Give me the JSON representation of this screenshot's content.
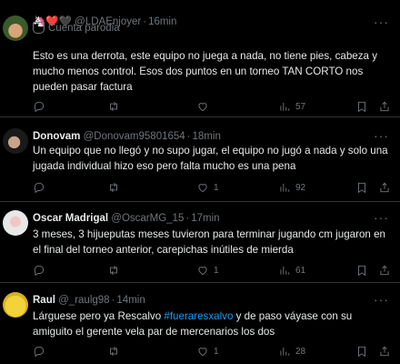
{
  "tweets": [
    {
      "display_name": "",
      "handle": "@LDAEnjoyer",
      "time": "16min",
      "badge": "Cuenta parodia",
      "text": "Esto es una derrota, este equipo no juega a nada, no tiene pies, cabeza y mucho menos control. Esos dos puntos en un torneo TAN CORTO nos pueden pasar factura",
      "views": "57",
      "likes": "",
      "emoji_prefix": "🦄❤️🖤"
    },
    {
      "display_name": "Donovam",
      "handle": "@Donovam95801654",
      "time": "18min",
      "text": "Un equipo que no llegó y no supo jugar, el equipo no jugó a nada y solo una jugada individual hizo eso pero falta mucho es una pena",
      "likes": "1",
      "views": "92"
    },
    {
      "display_name": "Oscar Madrigal",
      "handle": "@OscarMG_15",
      "time": "17min",
      "text": "3 meses, 3 hijueputas meses tuvieron para terminar jugando cm jugaron en el final del torneo anterior, carepichas inútiles de mierda",
      "likes": "1",
      "views": "61"
    },
    {
      "display_name": "Raul",
      "handle": "@_raulg98",
      "time": "14min",
      "text_before": "Lárguese pero ya Rescalvo ",
      "hashtag": "#fueraresxalvo",
      "text_after": " y de paso váyase con su amiguito el gerente vela par de mercenarios los dos",
      "likes": "1",
      "views": "28"
    }
  ],
  "icons": {
    "reply": "reply-icon",
    "retweet": "retweet-icon",
    "like": "heart-icon",
    "views": "views-icon",
    "bookmark": "bookmark-icon",
    "share": "share-icon",
    "more": "more-icon",
    "parody": "parody-mask-icon"
  },
  "colors": {
    "background": "#000000",
    "text": "#e7e9ea",
    "muted": "#71767b",
    "link": "#1d9bf0",
    "divider": "#2f3336"
  }
}
